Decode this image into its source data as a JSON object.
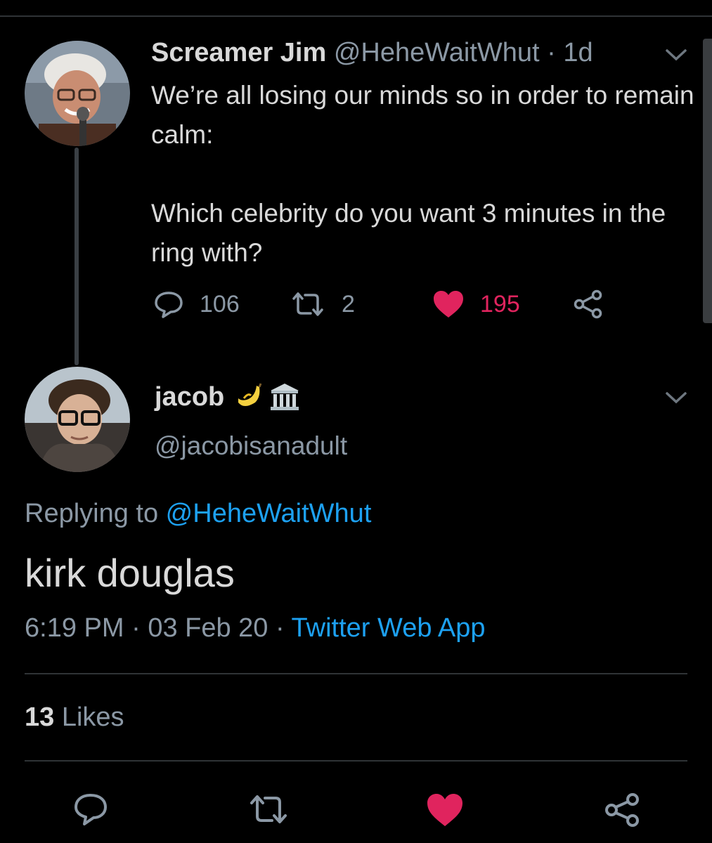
{
  "parent_tweet": {
    "author_name": "Screamer Jim",
    "handle": "@HeheWaitWhut",
    "separator": "·",
    "time": "1d",
    "text": "We’re all losing our minds so in order to remain calm:\n\nWhich celebrity do you want 3 minutes in the ring with?",
    "replies": "106",
    "retweets": "2",
    "likes": "195",
    "like_color": "#e0245e"
  },
  "reply_tweet": {
    "author_name": "jacob",
    "name_emojis": [
      "banana-emoji",
      "classical-building-emoji"
    ],
    "handle": "@jacobisanadult",
    "replying_prefix": "Replying to ",
    "replying_handle": "@HeheWaitWhut",
    "text": "kirk douglas",
    "time": "6:19 PM",
    "dot1": " · ",
    "date": "03 Feb 20",
    "dot2": " · ",
    "source": "Twitter Web App",
    "likes_count": "13",
    "likes_label": " Likes"
  },
  "colors": {
    "background": "#000000",
    "text": "#d9d9d9",
    "muted": "#8b98a5",
    "accent": "#1da1f2",
    "like": "#e0245e"
  },
  "icons": [
    "chevron-down-icon",
    "reply-icon",
    "retweet-icon",
    "heart-icon",
    "share-icon"
  ]
}
